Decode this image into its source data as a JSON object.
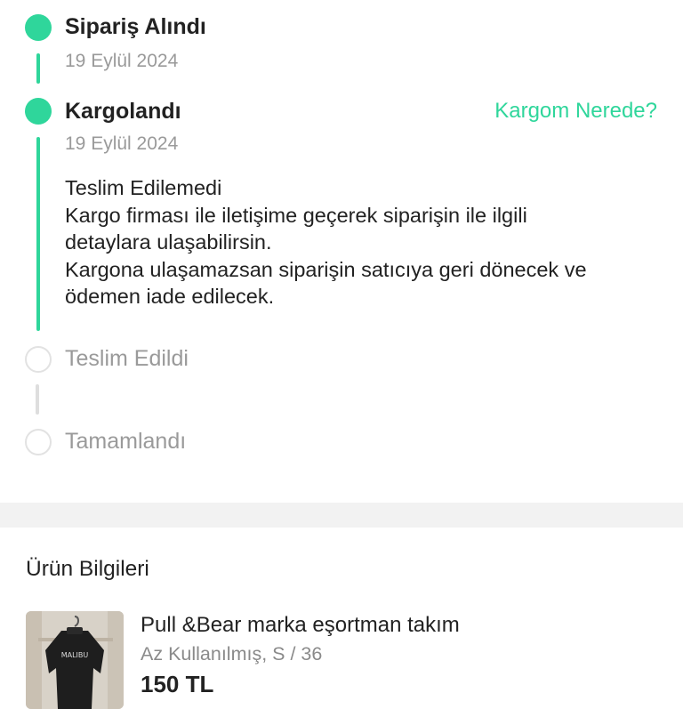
{
  "timeline": {
    "steps": [
      {
        "title": "Sipariş Alındı",
        "date": "19 Eylül 2024",
        "status": "done"
      },
      {
        "title": "Kargolandı",
        "date": "19 Eylül 2024",
        "status": "done",
        "link": "Kargom Nerede?",
        "message": {
          "heading": "Teslim Edilemedi",
          "lines": [
            "Kargo firması ile iletişime geçerek siparişin ile ilgili",
            "detaylara ulaşabilirsin.",
            "Kargona ulaşamazsan siparişin satıcıya geri dönecek ve",
            "ödemen iade edilecek."
          ]
        }
      },
      {
        "title": "Teslim Edildi",
        "status": "pending"
      },
      {
        "title": "Tamamlandı",
        "status": "pending"
      }
    ],
    "colors": {
      "accent": "#2fd69b",
      "pending": "#dedede"
    }
  },
  "product_section": {
    "title": "Ürün Bilgileri",
    "product": {
      "name": "Pull &Bear marka eşortman takım",
      "meta": "Az Kullanılmış, S / 36",
      "price": "150 TL",
      "image_text": "MALIBU"
    }
  }
}
